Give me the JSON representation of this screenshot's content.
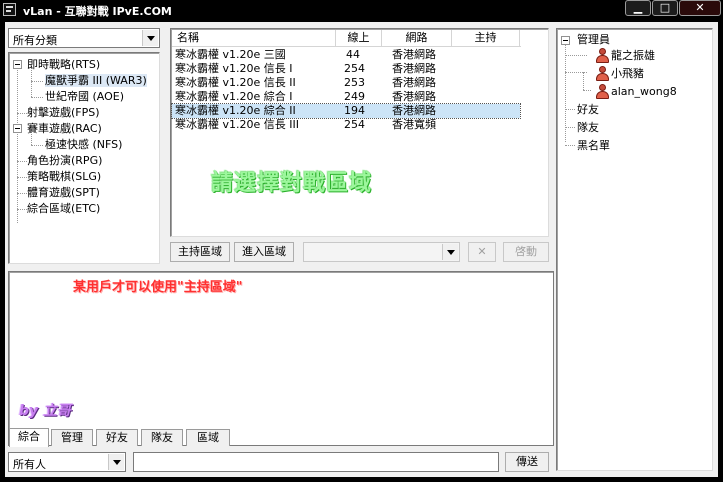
{
  "window": {
    "title": "vLan - 互聯對戰 IPvE.COM",
    "minimize": "▁",
    "maximize": "□",
    "close": "✕"
  },
  "category_filter": {
    "selected": "所有分類"
  },
  "categories": {
    "items": [
      {
        "label": "即時戰略(RTS)"
      },
      {
        "label": "魔獸爭霸 III (WAR3)"
      },
      {
        "label": "世紀帝國 (AOE)"
      },
      {
        "label": "射擊遊戲(FPS)"
      },
      {
        "label": "賽車遊戲(RAC)"
      },
      {
        "label": "極速快感 (NFS)"
      },
      {
        "label": "角色扮演(RPG)"
      },
      {
        "label": "策略戰棋(SLG)"
      },
      {
        "label": "體育遊戲(SPT)"
      },
      {
        "label": "綜合區域(ETC)"
      }
    ]
  },
  "room_list": {
    "columns": [
      "名稱",
      "線上",
      "網路",
      "主持"
    ],
    "rows": [
      {
        "name": "寒冰霸權 v1.20e 三國",
        "online": "44",
        "network": "香港網路",
        "host": ""
      },
      {
        "name": "寒冰霸權 v1.20e 信長 I",
        "online": "254",
        "network": "香港網路",
        "host": ""
      },
      {
        "name": "寒冰霸權 v1.20e 信長 II",
        "online": "253",
        "network": "香港網路",
        "host": ""
      },
      {
        "name": "寒冰霸權 v1.20e 綜合 I",
        "online": "249",
        "network": "香港網路",
        "host": ""
      },
      {
        "name": "寒冰霸權 v1.20e 綜合 II",
        "online": "194",
        "network": "香港網路",
        "host": ""
      },
      {
        "name": "寒冰霸權 v1.20e 信長 III",
        "online": "254",
        "network": "香港寬頻",
        "host": ""
      }
    ],
    "hint": "請選擇對戰區域"
  },
  "room_toolbar": {
    "host_area": "主持區域",
    "enter_area": "進入區域",
    "select_value": "",
    "delete_symbol": "✕",
    "start_label": "啓動"
  },
  "chat": {
    "message": "某用戶才可以使用\"主持區域\"",
    "signature": "by 立哥",
    "tabs": [
      "綜合",
      "管理",
      "好友",
      "隊友",
      "區域"
    ],
    "recipient": "所有人",
    "input_value": "",
    "send_label": "傳送"
  },
  "user_panel": {
    "groups": [
      {
        "label": "管理員",
        "members": [
          "龍之振雄",
          "小飛豬",
          "alan_wong8"
        ]
      },
      {
        "label": "好友",
        "members": []
      },
      {
        "label": "隊友",
        "members": []
      },
      {
        "label": "黑名單",
        "members": []
      }
    ]
  }
}
